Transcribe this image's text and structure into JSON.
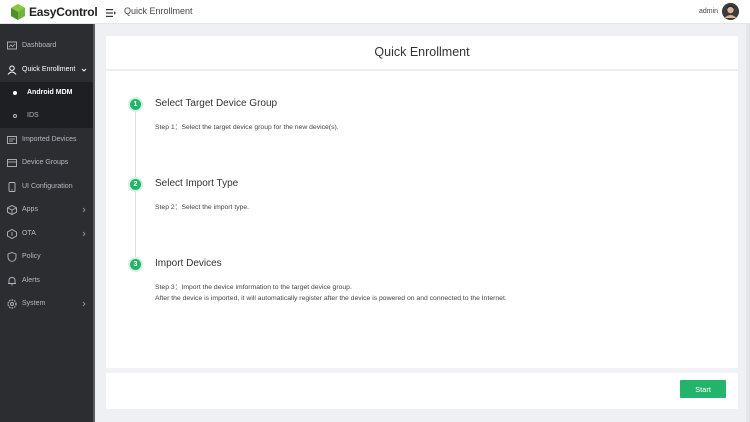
{
  "app": {
    "name": "EasyControl",
    "brand_color": "#6db33f"
  },
  "header": {
    "title": "Quick Enrollment",
    "menu_icon": "menu-fold-icon",
    "user": "admin"
  },
  "sidebar": {
    "items": [
      {
        "label": "Dashboard",
        "icon": "dashboard-icon"
      },
      {
        "label": "Quick Enrollment",
        "icon": "user-icon",
        "expanded": true
      },
      {
        "label": "Imported Devices",
        "icon": "import-icon"
      },
      {
        "label": "Device Groups",
        "icon": "folder-icon"
      },
      {
        "label": "UI Configuration",
        "icon": "ui-icon"
      },
      {
        "label": "Apps",
        "icon": "cube-icon",
        "has_children": true
      },
      {
        "label": "OTA",
        "icon": "ota-icon",
        "has_children": true
      },
      {
        "label": "Policy",
        "icon": "shield-icon"
      },
      {
        "label": "Alerts",
        "icon": "bell-icon"
      },
      {
        "label": "System",
        "icon": "gear-icon",
        "has_children": true
      }
    ],
    "submenu": [
      {
        "label": "Android MDM",
        "active": true
      },
      {
        "label": "IDS",
        "active": false
      }
    ]
  },
  "main": {
    "title": "Quick Enrollment",
    "steps": [
      {
        "number": "1",
        "title": "Select Target Device Group",
        "lines": [
          "Step 1：Select the target device group  for the new device(s)."
        ]
      },
      {
        "number": "2",
        "title": "Select Import Type",
        "lines": [
          "Step 2：Select the import type."
        ]
      },
      {
        "number": "3",
        "title": "Import Devices",
        "lines": [
          "Step 3：Import the device imformation to the target device group.",
          "After the device is imported, it will automatically register after the device is powered on and  connected to the Internet."
        ]
      }
    ],
    "start_button": "Start"
  },
  "colors": {
    "accent": "#23b36a",
    "sidebar_bg": "#2b2d31",
    "submenu_bg": "#1e1f22"
  }
}
